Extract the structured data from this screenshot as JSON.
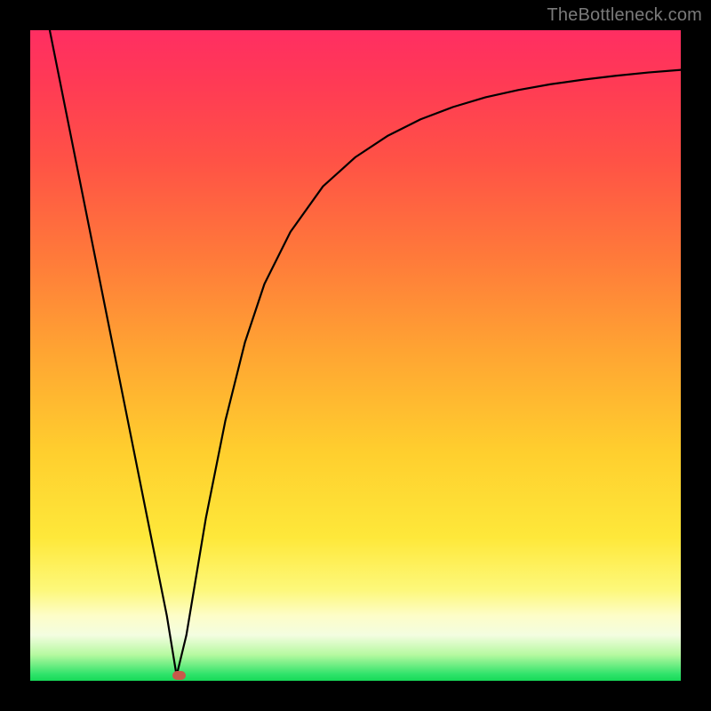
{
  "watermark": "TheBottleneck.com",
  "chart_data": {
    "type": "line",
    "title": "",
    "xlabel": "",
    "ylabel": "",
    "xlim": [
      0,
      100
    ],
    "ylim": [
      0,
      100
    ],
    "grid": false,
    "series": [
      {
        "name": "curve",
        "x": [
          3,
          6,
          9,
          12,
          15,
          18,
          21,
          22.5,
          24,
          27,
          30,
          33,
          36,
          40,
          45,
          50,
          55,
          60,
          65,
          70,
          75,
          80,
          85,
          90,
          95,
          100
        ],
        "values": [
          100,
          85,
          70,
          55,
          40,
          25,
          10,
          0.8,
          7,
          25,
          40,
          52,
          61,
          69,
          76,
          80.5,
          83.8,
          86.3,
          88.2,
          89.7,
          90.8,
          91.7,
          92.4,
          93,
          93.5,
          93.9
        ]
      }
    ],
    "marker": {
      "x": 22.8,
      "y": 0.8,
      "color": "#c85a4a"
    },
    "background_gradient": {
      "direction": "vertical",
      "stops": [
        {
          "pos": 0,
          "color": "#ff2e62"
        },
        {
          "pos": 50,
          "color": "#ffa632"
        },
        {
          "pos": 86,
          "color": "#fdf87a"
        },
        {
          "pos": 100,
          "color": "#17da58"
        }
      ]
    }
  }
}
